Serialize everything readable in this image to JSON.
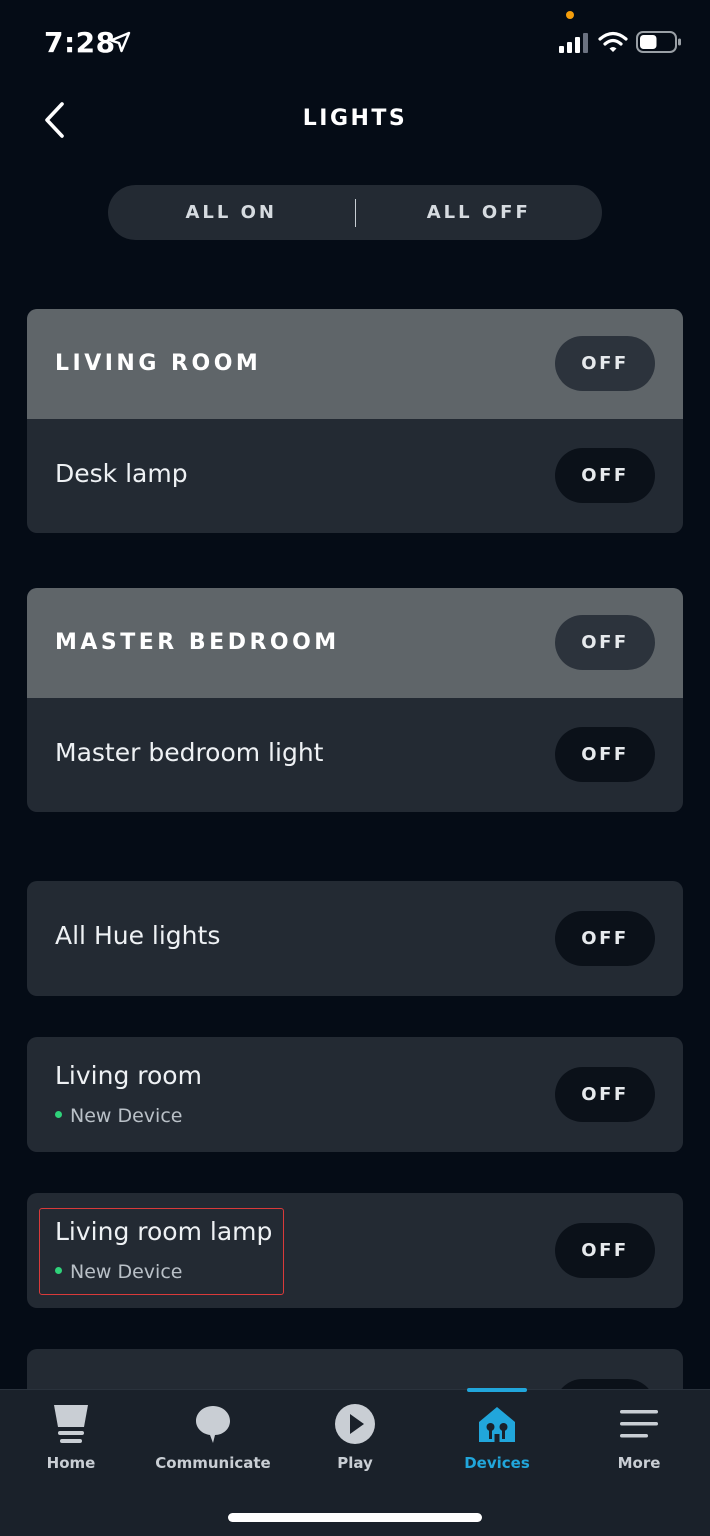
{
  "status_bar": {
    "time": "7:28",
    "location_icon": "location-arrow-icon",
    "signal_icon": "cellular-signal-icon",
    "wifi_icon": "wifi-icon",
    "battery_icon": "battery-icon",
    "battery_level": 0.5
  },
  "header": {
    "title": "LIGHTS",
    "back_icon": "chevron-left-icon"
  },
  "all_controls": {
    "all_on_label": "ALL ON",
    "all_off_label": "ALL OFF"
  },
  "groups": [
    {
      "title": "LIVING ROOM",
      "state": "OFF",
      "devices": [
        {
          "name": "Desk lamp",
          "state": "OFF"
        }
      ]
    },
    {
      "title": "MASTER BEDROOM",
      "state": "OFF",
      "devices": [
        {
          "name": "Master bedroom light",
          "state": "OFF"
        }
      ]
    }
  ],
  "devices": [
    {
      "name": "All Hue lights",
      "state": "OFF"
    },
    {
      "name": "Living room",
      "subtitle": "New Device",
      "state": "OFF"
    },
    {
      "name": "Living room lamp",
      "subtitle": "New Device",
      "state": "OFF"
    }
  ],
  "colors": {
    "accent": "#21a6db",
    "new_device_dot": "#2fd27a",
    "highlight_border": "#d93a3a"
  },
  "bottom_nav": {
    "items": [
      {
        "label": "Home",
        "icon": "home-icon"
      },
      {
        "label": "Communicate",
        "icon": "chat-bubble-icon"
      },
      {
        "label": "Play",
        "icon": "play-icon"
      },
      {
        "label": "Devices",
        "icon": "devices-house-icon",
        "active": true
      },
      {
        "label": "More",
        "icon": "menu-icon"
      }
    ]
  }
}
